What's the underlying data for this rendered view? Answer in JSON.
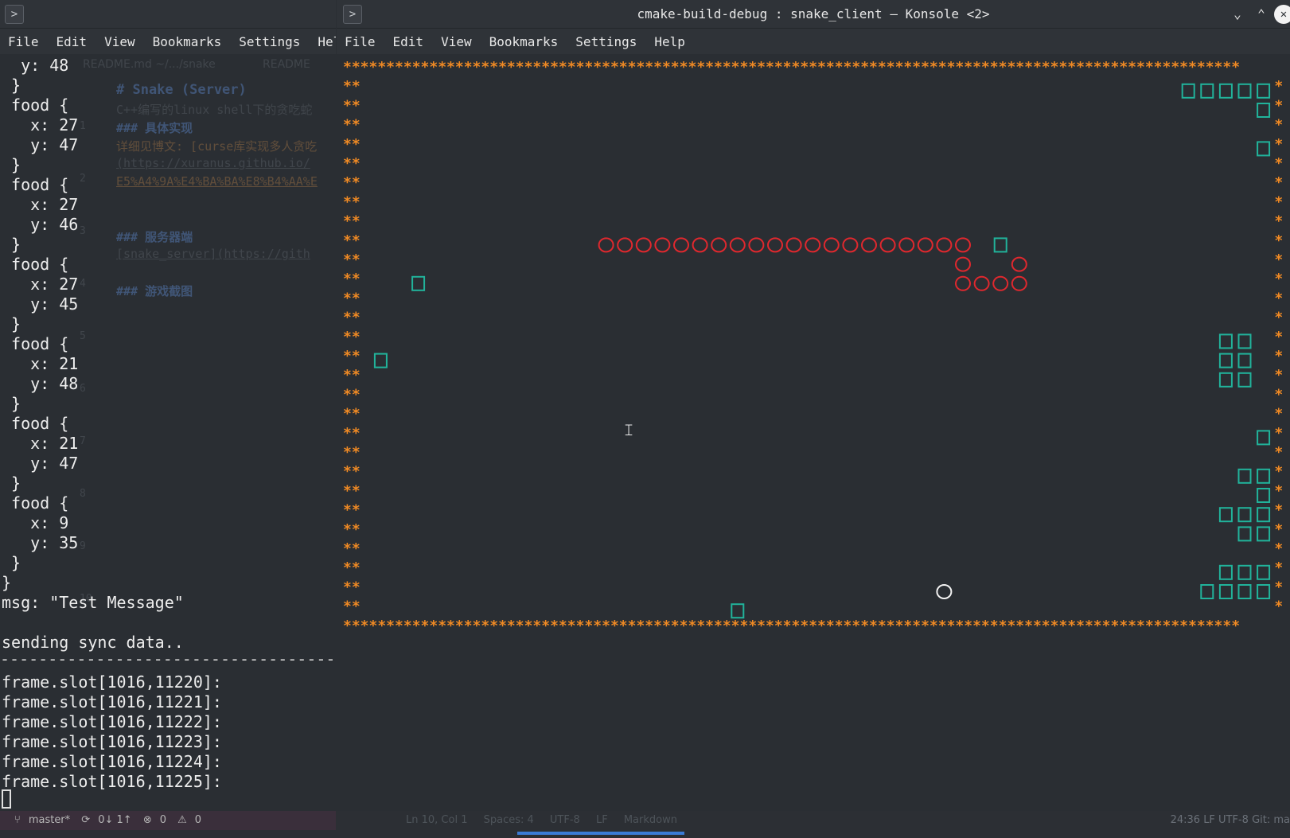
{
  "left_terminal": {
    "menu": [
      "File",
      "Edit",
      "View",
      "Bookmarks",
      "Settings",
      "Help"
    ],
    "output_lines": [
      "  y: 48",
      " }",
      " food {",
      "   x: 27",
      "   y: 47",
      " }",
      " food {",
      "   x: 27",
      "   y: 46",
      " }",
      " food {",
      "   x: 27",
      "   y: 45",
      " }",
      " food {",
      "   x: 21",
      "   y: 48",
      " }",
      " food {",
      "   x: 21",
      "   y: 47",
      " }",
      " food {",
      "   x: 9",
      "   y: 35",
      " }",
      "}",
      "msg: \"Test Message\"",
      "",
      "sending sync data..",
      "",
      "frame.slot[1016,11220]:",
      "frame.slot[1016,11221]:",
      "frame.slot[1016,11222]:",
      "frame.slot[1016,11223]:",
      "frame.slot[1016,11224]:",
      "frame.slot[1016,11225]:"
    ],
    "separator": "--------------------------------------------------"
  },
  "background_editor": {
    "tab1": "README.md ~/.../snake",
    "tab2": "README",
    "line_numbers": [
      "1",
      "2",
      "3",
      "4",
      "5",
      "6",
      "7",
      "8",
      "9",
      "10"
    ],
    "lines": [
      "# Snake (Server)",
      "C++编写的linux shell下的贪吃蛇",
      "### 具体实现",
      "详细见博文: [curse库实现多人贪吃",
      "(https://xuranus.github.io/",
      "E5%A4%9A%E4%BA%BA%E8%B4%AA%E",
      "",
      "### 服务器端",
      "[snake_server](https://gith",
      "### 游戏截图"
    ]
  },
  "right_terminal": {
    "title": "cmake-build-debug : snake_client — Konsole <2>",
    "menu": [
      "File",
      "Edit",
      "View",
      "Bookmarks",
      "Settings",
      "Help"
    ],
    "window_controls": {
      "minimize": "⌄",
      "maximize": "⌃",
      "close": "✕"
    },
    "game": {
      "cols": 49,
      "rows": 29,
      "border_char": "*",
      "wall_color": "#f08a24",
      "snake_color": "#e0282e",
      "food_color": "#21b39b",
      "player_color": "#f2f2f2",
      "snake_segments": [
        [
          13,
          9
        ],
        [
          14,
          9
        ],
        [
          15,
          9
        ],
        [
          16,
          9
        ],
        [
          17,
          9
        ],
        [
          18,
          9
        ],
        [
          19,
          9
        ],
        [
          20,
          9
        ],
        [
          21,
          9
        ],
        [
          22,
          9
        ],
        [
          23,
          9
        ],
        [
          24,
          9
        ],
        [
          25,
          9
        ],
        [
          26,
          9
        ],
        [
          27,
          9
        ],
        [
          28,
          9
        ],
        [
          29,
          9
        ],
        [
          30,
          9
        ],
        [
          31,
          9
        ],
        [
          32,
          9
        ],
        [
          32,
          10
        ],
        [
          35,
          10
        ],
        [
          32,
          11
        ],
        [
          33,
          11
        ],
        [
          34,
          11
        ],
        [
          35,
          11
        ]
      ],
      "player_snake": [
        [
          31,
          27
        ]
      ],
      "food": [
        [
          44,
          1
        ],
        [
          45,
          1
        ],
        [
          46,
          1
        ],
        [
          47,
          1
        ],
        [
          48,
          1
        ],
        [
          48,
          2
        ],
        [
          48,
          4
        ],
        [
          34,
          9
        ],
        [
          3,
          11
        ],
        [
          46,
          14
        ],
        [
          47,
          14
        ],
        [
          1,
          15
        ],
        [
          46,
          15
        ],
        [
          47,
          15
        ],
        [
          46,
          16
        ],
        [
          47,
          16
        ],
        [
          48,
          19
        ],
        [
          47,
          21
        ],
        [
          48,
          21
        ],
        [
          48,
          22
        ],
        [
          46,
          23
        ],
        [
          47,
          23
        ],
        [
          48,
          23
        ],
        [
          47,
          24
        ],
        [
          48,
          24
        ],
        [
          46,
          26
        ],
        [
          47,
          26
        ],
        [
          48,
          26
        ],
        [
          45,
          27
        ],
        [
          46,
          27
        ],
        [
          47,
          27
        ],
        [
          48,
          27
        ],
        [
          20,
          28
        ]
      ]
    }
  },
  "status_bar": {
    "branch": "master*",
    "sync": "0↓ 1↑",
    "errors": "0",
    "warnings": "0",
    "editor_info": [
      "Ln 10, Col 1",
      "Spaces: 4",
      "UTF-8",
      "LF",
      "Markdown"
    ],
    "right_info": "24:36  LF  UTF-8  Git: ma"
  }
}
